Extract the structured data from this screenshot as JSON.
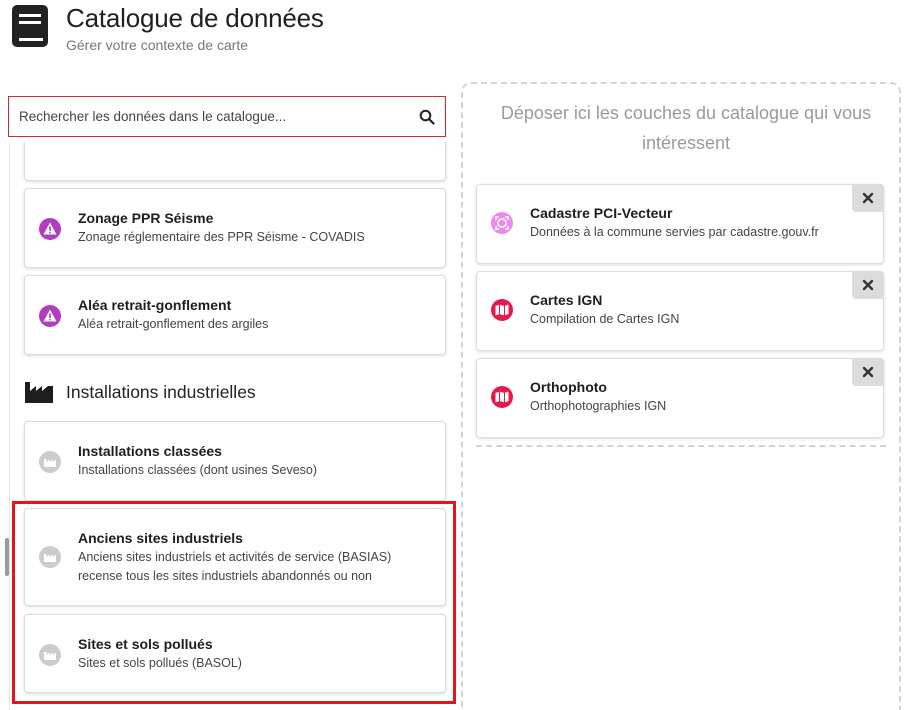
{
  "header": {
    "title": "Catalogue de données",
    "subtitle": "Gérer votre contexte de carte",
    "icon": "book-icon"
  },
  "search": {
    "placeholder": "Rechercher les données dans le catalogue...",
    "value": ""
  },
  "catalog": {
    "items_top": [
      {
        "title": "Zonage PPR Séisme",
        "description": "Zonage réglementaire des PPR Séisme - COVADIS",
        "icon": "warning-icon"
      },
      {
        "title": "Aléa retrait-gonflement",
        "description": "Aléa retrait-gonflement des argiles",
        "icon": "warning-icon"
      }
    ],
    "section": {
      "label": "Installations industrielles",
      "icon": "factory-icon"
    },
    "items_section": [
      {
        "title": "Installations classées",
        "description": "Installations classées (dont usines Seveso)",
        "icon": "factory-icon"
      },
      {
        "title": "Anciens sites industriels",
        "description_line1": "Anciens sites industriels et activités de service (BASIAS)",
        "description_line2": "recense tous les sites industriels abandonnés ou non",
        "icon": "factory-icon"
      },
      {
        "title": "Sites et sols pollués",
        "description": "Sites et sols pollués (BASOL)",
        "icon": "factory-icon"
      }
    ]
  },
  "dropzone": {
    "text": "Déposer ici les couches du catalogue qui vous intéressent",
    "layers": [
      {
        "title": "Cadastre PCI-Vecteur",
        "description": "Données à la commune servies par cadastre.gouv.fr",
        "icon": "cadastre-icon"
      },
      {
        "title": "Cartes IGN",
        "description": "Compilation de Cartes IGN",
        "icon": "map-icon"
      },
      {
        "title": "Orthophoto",
        "description": "Orthophotographies IGN",
        "icon": "map-icon"
      }
    ]
  },
  "colors": {
    "search_border": "#d32a2a",
    "highlight": "#e3141e",
    "warning_purple": "#b23cc0",
    "cadastre_pink": "#ee88ee",
    "map_red": "#e8194a",
    "factory_grey": "#cccccc"
  }
}
